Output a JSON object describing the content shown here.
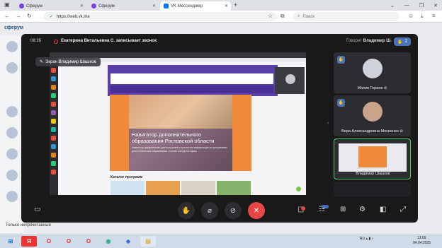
{
  "browser": {
    "tabs": [
      {
        "label": "Сферум",
        "active": false
      },
      {
        "label": "Сферум",
        "active": false
      },
      {
        "label": "VK Мессенджер",
        "active": true
      }
    ],
    "new_tab": "+",
    "url": "https://web.vk.me",
    "search_placeholder": "Поиск",
    "window_controls": {
      "minimize": "—",
      "restore": "❐",
      "close": "✕"
    }
  },
  "page": {
    "logo": "сферум",
    "filter": "Только непрочитанные"
  },
  "call": {
    "clock": "08:35",
    "recording_text": "Екатерина Витальевна С. записывает звонок",
    "speaking_prefix": "Говорит",
    "speaking_name": "Владимир Ш.",
    "hands_count": "2",
    "presenter_label": "Экран Владимир Шашков",
    "participants": [
      {
        "name": "Малик Гериев",
        "hand": true,
        "muted": true
      },
      {
        "name": "Вера Александровна Мосиенко",
        "hand": true,
        "muted": true
      },
      {
        "name": "Владимир Шашков",
        "hand": false,
        "muted": false
      }
    ],
    "controls": [
      "screen-share",
      "raise-hand",
      "camera-off",
      "microphone-off",
      "end-call",
      "chat",
      "participants",
      "grid",
      "settings",
      "pip",
      "fullscreen"
    ]
  },
  "shared_screen": {
    "banner_title": "Навигатор дополнительного образования Ростовской области",
    "banner_sub": "Навигатор предназначен для получения и просмотра информации по программам дополнительного образования. Ссылки находятся здесь",
    "catalog": "Каталог программ"
  },
  "taskbar": {
    "lang": "RU",
    "time": "11:09",
    "date": "04.04.2025"
  },
  "colors": {
    "accent": "#4a73b8",
    "end_call": "#e64646",
    "active_speaker": "#4fcf6a",
    "banner_orange": "#f08a3a",
    "banner_purple": "#5b3fa8"
  }
}
